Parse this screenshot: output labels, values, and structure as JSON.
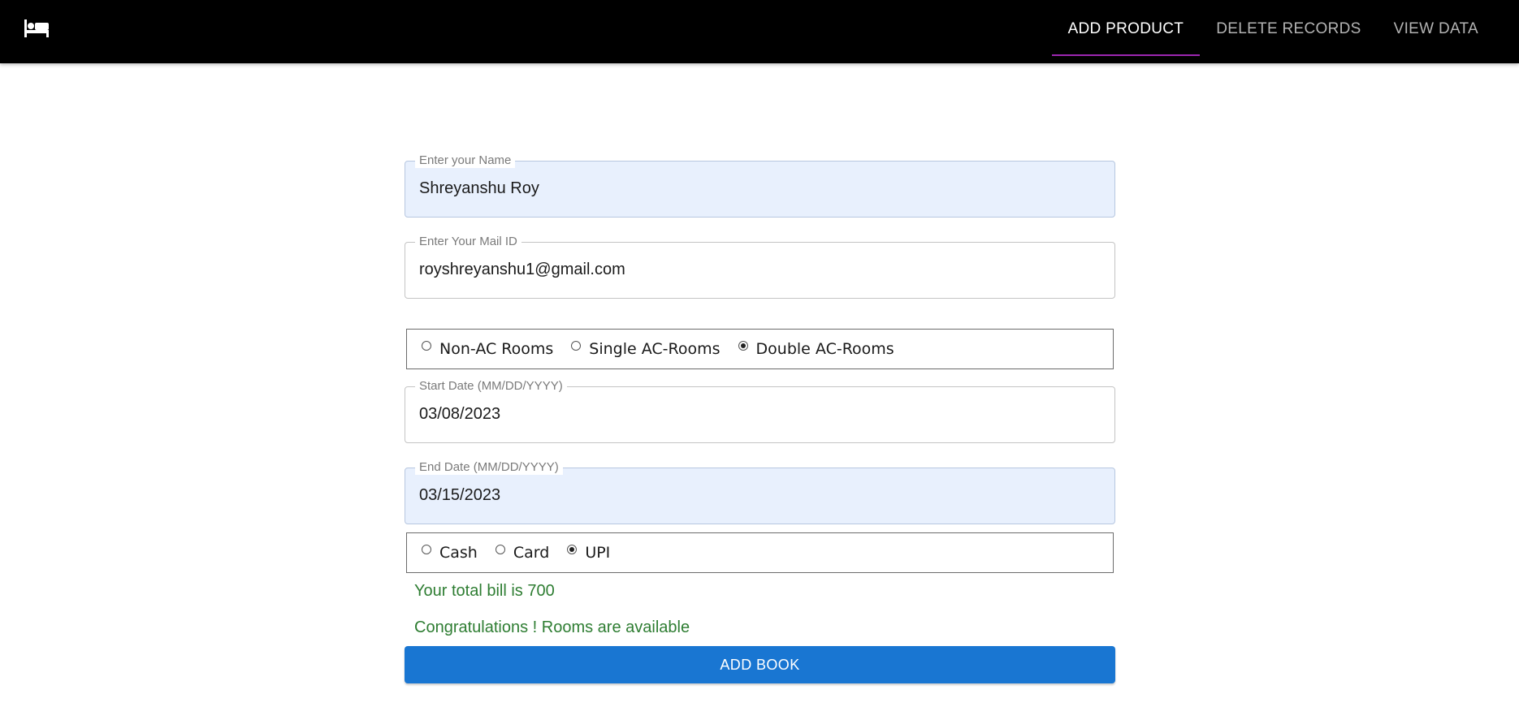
{
  "header": {
    "logo_icon": "bed-icon",
    "tabs": [
      {
        "label": "ADD PRODUCT",
        "active": true
      },
      {
        "label": "DELETE RECORDS",
        "active": false
      },
      {
        "label": "VIEW DATA",
        "active": false
      }
    ],
    "active_indicator_color": "#9c27b0"
  },
  "form": {
    "name": {
      "label": "Enter your Name",
      "value": "Shreyanshu Roy"
    },
    "email": {
      "label": "Enter Your Mail ID",
      "value": "royshreyanshu1@gmail.com"
    },
    "room_type": {
      "options": [
        "Non-AC Rooms",
        "Single AC-Rooms",
        "Double AC-Rooms"
      ],
      "selected": "Double AC-Rooms"
    },
    "start_date": {
      "label": "Start Date (MM/DD/YYYY)",
      "value": "03/08/2023"
    },
    "end_date": {
      "label": "End Date (MM/DD/YYYY)",
      "value": "03/15/2023"
    },
    "payment": {
      "options": [
        "Cash",
        "Card",
        "UPI"
      ],
      "selected": "UPI"
    },
    "bill_message": "Your total bill is 700",
    "availability_message": "Congratulations ! Rooms are available",
    "submit_label": "ADD BOOK"
  },
  "colors": {
    "appbar": "#000000",
    "filled_field": "#e8f0fd",
    "success_text": "#2e7d32",
    "primary_button": "#1976d2"
  }
}
